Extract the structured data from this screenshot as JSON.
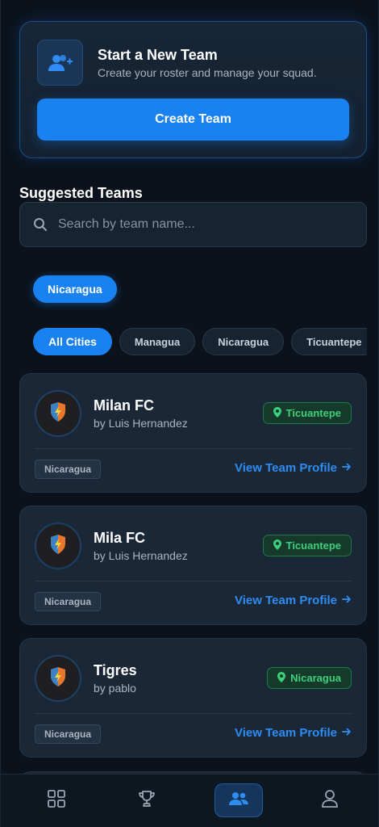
{
  "new_team": {
    "title": "Start a New Team",
    "subtitle": "Create your roster and manage your squad.",
    "button_label": "Create Team",
    "icon": "add-user-icon"
  },
  "suggested": {
    "title": "Suggested Teams",
    "search_placeholder": "Search by team name..."
  },
  "country_filter": {
    "selected": "Nicaragua"
  },
  "city_filters": [
    "All Cities",
    "Managua",
    "Nicaragua",
    "Ticuantepe"
  ],
  "teams": [
    {
      "name": "Milan FC",
      "owner": "by Luis Hernandez",
      "city": "Ticuantepe",
      "country": "Nicaragua",
      "link": "View Team Profile"
    },
    {
      "name": "Mila FC",
      "owner": "by Luis Hernandez",
      "city": "Ticuantepe",
      "country": "Nicaragua",
      "link": "View Team Profile"
    },
    {
      "name": "Tigres",
      "owner": "by pablo",
      "city": "Nicaragua",
      "country": "Nicaragua",
      "link": "View Team Profile"
    }
  ],
  "nav": {
    "items": [
      "dashboard-icon",
      "trophy-icon",
      "team-icon",
      "profile-icon"
    ],
    "active": "team-icon"
  },
  "colors": {
    "accent": "#1a82f0",
    "background": "#0b121b",
    "card": "#1a2736",
    "location_green": "#3fcf7b"
  }
}
